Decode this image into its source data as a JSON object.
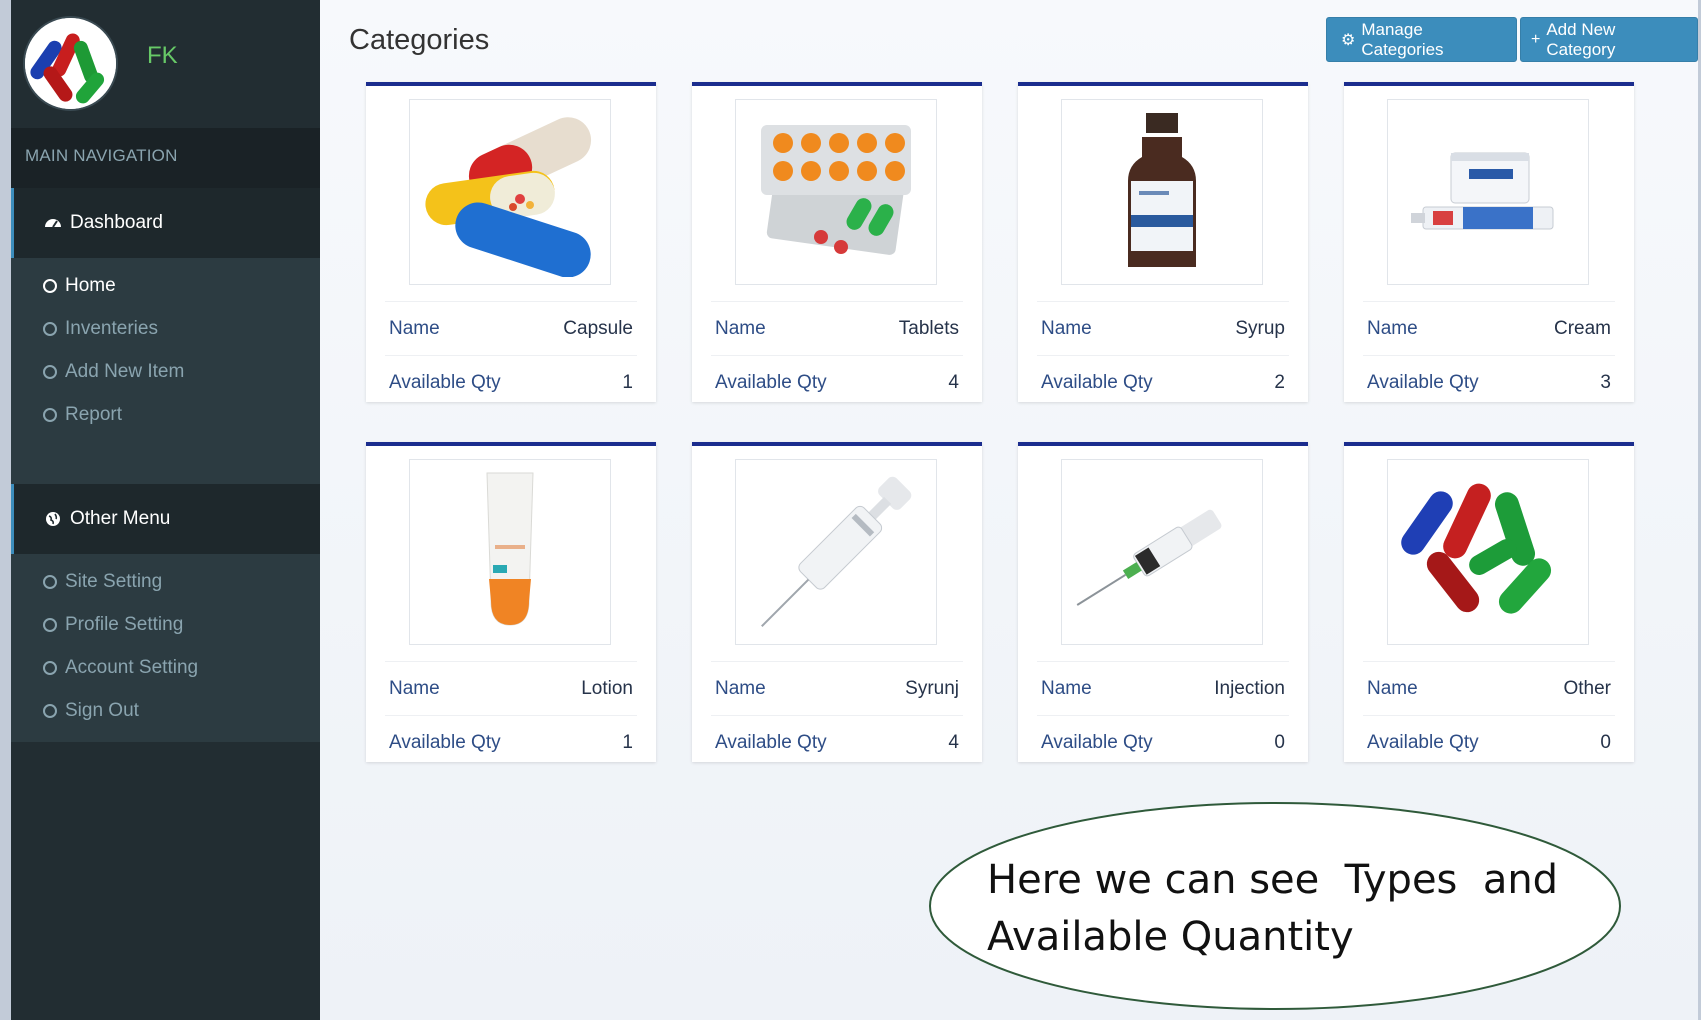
{
  "sidebar": {
    "username": "FK",
    "section_header": "MAIN NAVIGATION",
    "groups": [
      {
        "title": "Dashboard",
        "icon": "dashboard-icon",
        "items": [
          "Home",
          "Inventeries",
          "Add New Item",
          "Report"
        ]
      },
      {
        "title": "Other Menu",
        "icon": "globe-icon",
        "items": [
          "Site Setting",
          "Profile Setting",
          "Account Setting",
          "Sign Out"
        ]
      }
    ]
  },
  "main": {
    "title": "Categories",
    "buttons": {
      "manage": "Manage Categories",
      "add": "Add New Category"
    },
    "label_name": "Name",
    "label_qty": "Available Qty",
    "cards": [
      {
        "name": "Capsule",
        "qty": "1"
      },
      {
        "name": "Tablets",
        "qty": "4"
      },
      {
        "name": "Syrup",
        "qty": "2"
      },
      {
        "name": "Cream",
        "qty": "3"
      },
      {
        "name": "Lotion",
        "qty": "1"
      },
      {
        "name": "Syrunj",
        "qty": "4"
      },
      {
        "name": "Injection",
        "qty": "0"
      },
      {
        "name": "Other",
        "qty": "0"
      }
    ]
  },
  "callout": {
    "line1": "Here we can see  Types  and",
    "line2": "Available Quantity"
  },
  "colors": {
    "sidebar_bg": "#222d32",
    "accent": "#3c8dbc",
    "card_top_border": "#1b2d8e",
    "username": "#67c967"
  }
}
